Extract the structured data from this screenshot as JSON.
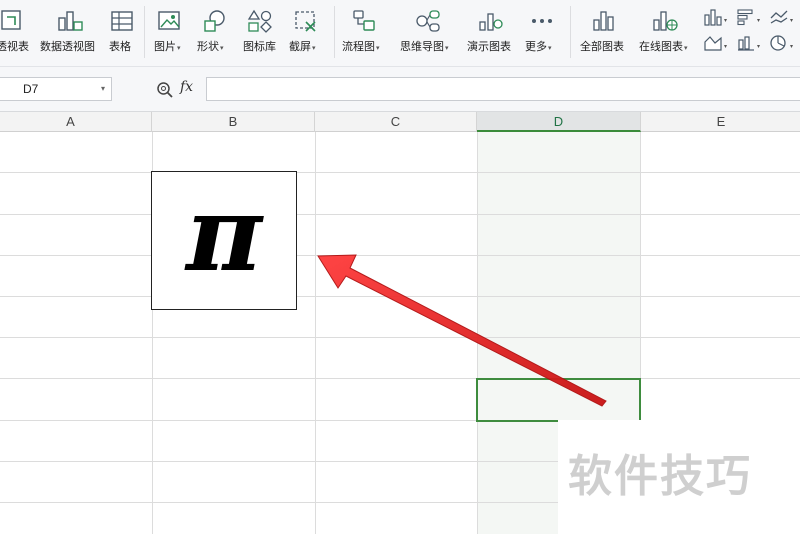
{
  "ribbon": {
    "items": [
      {
        "label": "透视表",
        "dropdown": false,
        "icon": "pivot-table-icon"
      },
      {
        "label": "数据透视图",
        "dropdown": false,
        "icon": "pivot-chart-icon"
      },
      {
        "label": "表格",
        "dropdown": false,
        "icon": "table-icon"
      },
      {
        "label": "图片",
        "dropdown": true,
        "icon": "picture-icon"
      },
      {
        "label": "形状",
        "dropdown": true,
        "icon": "shape-icon"
      },
      {
        "label": "图标库",
        "dropdown": false,
        "icon": "icon-library-icon"
      },
      {
        "label": "截屏",
        "dropdown": true,
        "icon": "screenshot-icon"
      },
      {
        "label": "流程图",
        "dropdown": true,
        "icon": "flowchart-icon"
      },
      {
        "label": "思维导图",
        "dropdown": true,
        "icon": "mind-map-icon"
      },
      {
        "label": "演示图表",
        "dropdown": false,
        "icon": "demo-chart-icon"
      },
      {
        "label": "更多",
        "dropdown": true,
        "icon": "more-icon"
      },
      {
        "label": "全部图表",
        "dropdown": false,
        "icon": "all-charts-icon"
      },
      {
        "label": "在线图表",
        "dropdown": true,
        "icon": "online-chart-icon"
      }
    ],
    "dropdown_glyph": "▾"
  },
  "formula_bar": {
    "cell_ref": "D7",
    "fx_label": "fx",
    "formula": ""
  },
  "grid": {
    "columns": [
      "A",
      "B",
      "C",
      "D",
      "E"
    ],
    "active_column": "D",
    "selected_cell": "D7"
  },
  "content": {
    "pi_symbol": "π",
    "watermark": "软件技巧"
  },
  "colors": {
    "accent_green": "#3e8c3e",
    "arrow_red": "#e01f1f"
  }
}
